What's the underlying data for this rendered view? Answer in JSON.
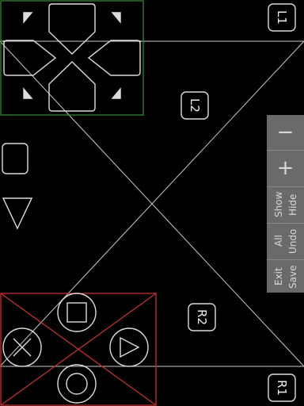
{
  "buttons": {
    "l1": "L1",
    "l2": "L2",
    "r1": "R1",
    "r2": "R2"
  },
  "side_menu": {
    "minus": "−",
    "plus": "+",
    "hide": "Hide",
    "show_all": "Show All",
    "undo": "Undo",
    "save_exit": "Save Exit"
  },
  "icons": {
    "dpad": "dpad-icon",
    "cross": "cross-icon",
    "circle": "circle-icon",
    "square": "square-icon",
    "triangle": "triangle-icon",
    "select": "select-icon",
    "start": "start-icon"
  },
  "colors": {
    "background": "#000000",
    "lines": "#d0d0d0",
    "dpad_frame": "#3a8a3a",
    "face_frame": "#c03030",
    "panel": "#6a6a6a",
    "panel_text": "#d8d8d8"
  }
}
